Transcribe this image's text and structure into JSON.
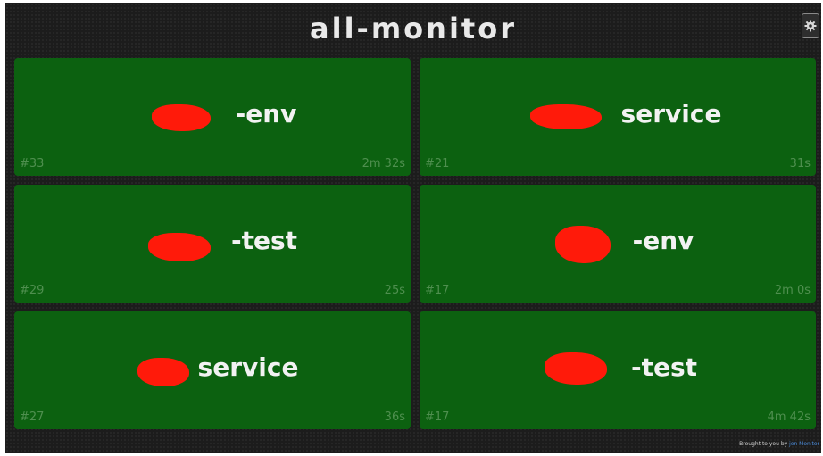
{
  "header": {
    "title": "all-monitor"
  },
  "tiles": [
    {
      "name": "-env",
      "build": "#33",
      "duration": "2m 32s"
    },
    {
      "name": "service",
      "build": "#21",
      "duration": "31s"
    },
    {
      "name": "-test",
      "build": "#29",
      "duration": "25s"
    },
    {
      "name": "-env",
      "build": "#17",
      "duration": "2m 0s"
    },
    {
      "name": "service",
      "build": "#27",
      "duration": "36s"
    },
    {
      "name": "-test",
      "build": "#17",
      "duration": "4m 42s"
    }
  ],
  "footer": {
    "prefix": "Brought to you by",
    "link": "jen Monitor"
  },
  "colors": {
    "background": "#1c1c1c",
    "tile_success": "#0c6110",
    "redaction": "#ff1a0a"
  },
  "icons": {
    "settings": "gear-icon"
  }
}
